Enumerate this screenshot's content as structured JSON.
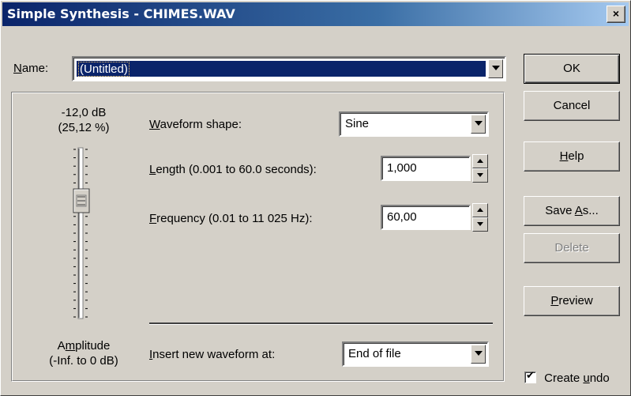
{
  "window": {
    "title": "Simple Synthesis - CHIMES.WAV",
    "close_glyph": "×"
  },
  "name_row": {
    "label_accel": "N",
    "label_rest": "ame:",
    "value": "(Untitled)"
  },
  "amplitude": {
    "db_value": "-12,0 dB",
    "percent_value": "(25,12 %)",
    "label_pre": "A",
    "label_accel": "m",
    "label_post": "plitude",
    "range": "(-Inf. to 0 dB)",
    "level_fraction": 0.72
  },
  "waveform": {
    "label_accel": "W",
    "label_rest": "aveform shape:",
    "value": "Sine"
  },
  "length": {
    "label_accel": "L",
    "label_rest": "ength (0.001 to 60.0 seconds):",
    "value": "1,000"
  },
  "frequency": {
    "label_accel": "F",
    "label_rest": "requency (0.01 to 11 025 Hz):",
    "value": "60,00"
  },
  "insert": {
    "label_accel": "I",
    "label_rest": "nsert new waveform at:",
    "value": "End of file"
  },
  "buttons": {
    "ok": "OK",
    "cancel": "Cancel",
    "help_accel": "H",
    "help_rest": "elp",
    "saveas_pre": "Save ",
    "saveas_accel": "A",
    "saveas_post": "s...",
    "delete": "Delete",
    "preview_accel": "P",
    "preview_rest": "review"
  },
  "create_undo": {
    "pre": "Create ",
    "accel": "u",
    "post": "ndo",
    "checked": true,
    "check_glyph": "✔"
  }
}
